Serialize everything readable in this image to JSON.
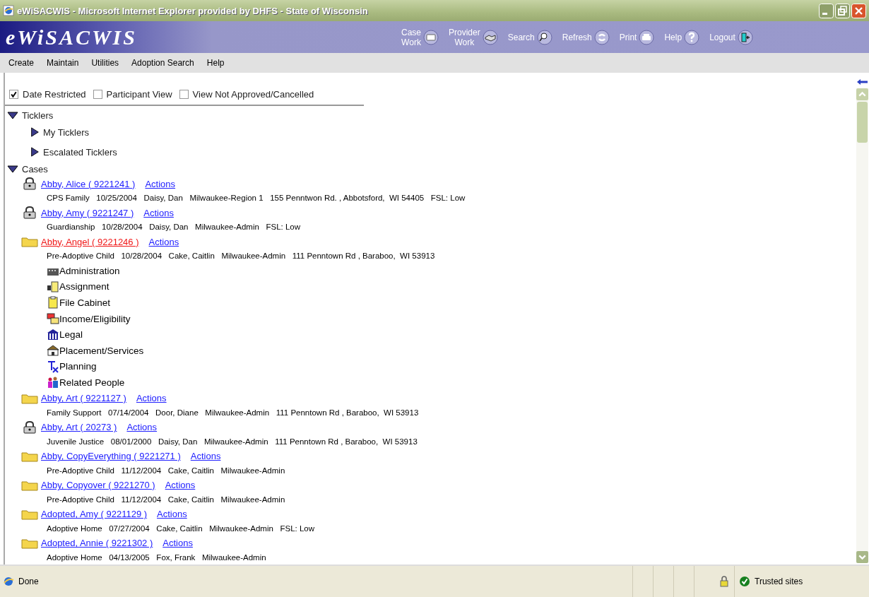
{
  "window": {
    "title": "eWiSACWIS - Microsoft Internet Explorer provided by DHFS - State of Wisconsin"
  },
  "header": {
    "logo": "eWiSACWIS",
    "toolbar": [
      {
        "label": [
          "Case",
          "Work"
        ],
        "kind": "folder"
      },
      {
        "label": [
          "Provider",
          "Work"
        ],
        "kind": "handshake"
      },
      {
        "label": [
          "Search"
        ],
        "kind": "search"
      },
      {
        "label": [
          "Refresh"
        ],
        "kind": "refresh"
      },
      {
        "label": [
          "Print"
        ],
        "kind": "print"
      },
      {
        "label": [
          "Help"
        ],
        "kind": "help"
      },
      {
        "label": [
          "Logout"
        ],
        "kind": "logout"
      }
    ]
  },
  "menu": [
    "Create",
    "Maintain",
    "Utilities",
    "Adoption Search",
    "Help"
  ],
  "filters": [
    {
      "label": "Date Restricted",
      "checked": true
    },
    {
      "label": "Participant View",
      "checked": false
    },
    {
      "label": "View Not Approved/Cancelled",
      "checked": false
    }
  ],
  "tree": [
    {
      "label": "Ticklers",
      "expanded": true,
      "children": [
        {
          "label": "My Ticklers",
          "expanded": false
        },
        {
          "label": "Escalated Ticklers",
          "expanded": false
        }
      ]
    },
    {
      "label": "Cases",
      "expanded": true
    }
  ],
  "cases": [
    {
      "kind": "lock",
      "name": "Abby, Alice ( 9221241 )",
      "action": "Actions",
      "details": "CPS Family   10/25/2004   Daisy, Dan   Milwaukee-Region 1   155 Penntwon Rd. , Abbotsford,  WI 54405   FSL: Low",
      "selected": false
    },
    {
      "kind": "lock",
      "name": "Abby, Amy ( 9221247 )",
      "action": "Actions",
      "details": "Guardianship   10/28/2004   Daisy, Dan   Milwaukee-Admin   FSL: Low",
      "selected": false
    },
    {
      "kind": "folder",
      "name": "Abby, Angel ( 9221246 )",
      "action": "Actions",
      "details": "Pre-Adoptive Child   10/28/2004   Cake, Caitlin   Milwaukee-Admin   111 Penntown Rd , Baraboo,  WI 53913",
      "selected": true,
      "children": [
        {
          "label": "Administration",
          "kind": "building"
        },
        {
          "label": "Assignment",
          "kind": "assignment"
        },
        {
          "label": "File Cabinet",
          "kind": "clipboard"
        },
        {
          "label": "Income/Eligibility",
          "kind": "income"
        },
        {
          "label": "Legal",
          "kind": "legal"
        },
        {
          "label": "Placement/Services",
          "kind": "house"
        },
        {
          "label": "Planning",
          "kind": "rx"
        },
        {
          "label": "Related People",
          "kind": "people"
        }
      ]
    },
    {
      "kind": "folder",
      "name": "Abby, Art ( 9221127 )",
      "action": "Actions",
      "details": "Family Support   07/14/2004   Door, Diane   Milwaukee-Admin   111 Penntown Rd , Baraboo,  WI 53913",
      "selected": false
    },
    {
      "kind": "lock",
      "name": "Abby, Art ( 20273 )",
      "action": "Actions",
      "details": "Juvenile Justice   08/01/2000   Daisy, Dan   Milwaukee-Admin   111 Penntown Rd , Baraboo,  WI 53913",
      "selected": false
    },
    {
      "kind": "folder",
      "name": "Abby, CopyEverything ( 9221271 )",
      "action": "Actions",
      "details": "Pre-Adoptive Child   11/12/2004   Cake, Caitlin   Milwaukee-Admin",
      "selected": false
    },
    {
      "kind": "folder",
      "name": "Abby, Copyover ( 9221270 )",
      "action": "Actions",
      "details": "Pre-Adoptive Child   11/12/2004   Cake, Caitlin   Milwaukee-Admin",
      "selected": false
    },
    {
      "kind": "folder",
      "name": "Adopted, Amy ( 9221129 )",
      "action": "Actions",
      "details": "Adoptive Home   07/27/2004   Cake, Caitlin   Milwaukee-Admin   FSL: Low",
      "selected": false
    },
    {
      "kind": "folder",
      "name": "Adopted, Annie ( 9221302 )",
      "action": "Actions",
      "details": "Adoptive Home   04/13/2005   Fox, Frank   Milwaukee-Admin",
      "selected": false
    }
  ],
  "status_bar": {
    "text": "Done",
    "zone": "Trusted sites"
  }
}
